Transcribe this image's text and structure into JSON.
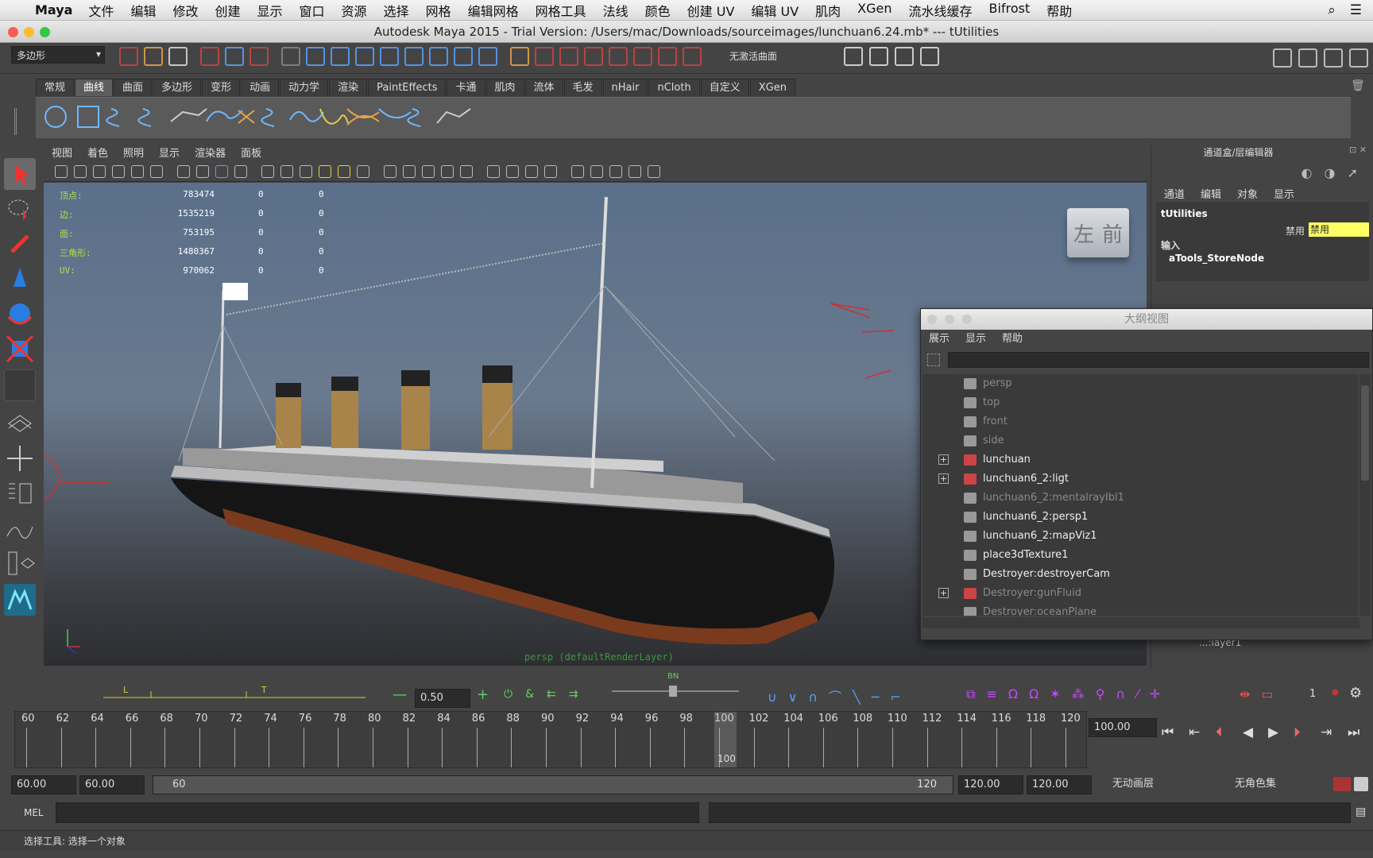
{
  "menubar": {
    "app": "Maya",
    "items": [
      "文件",
      "编辑",
      "修改",
      "创建",
      "显示",
      "窗口",
      "资源",
      "选择",
      "网格",
      "编辑网格",
      "网格工具",
      "法线",
      "颜色",
      "创建 UV",
      "编辑 UV",
      "肌肉",
      "XGen",
      "流水线缓存",
      "Bifrost",
      "帮助"
    ]
  },
  "window": {
    "title": "Autodesk Maya 2015 - Trial Version: /Users/mac/Downloads/sourceimages/lunchuan6.24.mb*   ---   tUtilities"
  },
  "statusline": {
    "menuset": "多边形",
    "live_surface": "无激活曲面"
  },
  "shelf": {
    "tabs": [
      "常规",
      "曲线",
      "曲面",
      "多边形",
      "变形",
      "动画",
      "动力学",
      "渲染",
      "PaintEffects",
      "卡通",
      "肌肉",
      "流体",
      "毛发",
      "nHair",
      "nCloth",
      "自定义",
      "XGen"
    ],
    "active": "曲线"
  },
  "viewport": {
    "menu": [
      "视图",
      "着色",
      "照明",
      "显示",
      "渲染器",
      "面板"
    ],
    "hud": [
      {
        "label": "顶点:",
        "v": "783474",
        "a": "0",
        "b": "0"
      },
      {
        "label": "边:",
        "v": "1535219",
        "a": "0",
        "b": "0"
      },
      {
        "label": "面:",
        "v": "753195",
        "a": "0",
        "b": "0"
      },
      {
        "label": "三角形:",
        "v": "1480367",
        "a": "0",
        "b": "0"
      },
      {
        "label": "UV:",
        "v": "970062",
        "a": "0",
        "b": "0"
      }
    ],
    "camera_label": "persp (defaultRenderLayer)",
    "viewcube_left": "左",
    "viewcube_front": "前"
  },
  "channelbox": {
    "title": "通道盒/层编辑器",
    "menu": [
      "通道",
      "编辑",
      "对象",
      "显示"
    ],
    "node": "tUtilities",
    "attr_label": "禁用",
    "attr_value": "禁用",
    "inputs_label": "输入",
    "input_node": "aTools_StoreNode",
    "layer": "...:layer1"
  },
  "outliner": {
    "title": "大纲视图",
    "menu": [
      "展示",
      "显示",
      "帮助"
    ],
    "rows": [
      {
        "name": "persp",
        "dim": true,
        "exp": false
      },
      {
        "name": "top",
        "dim": true,
        "exp": false
      },
      {
        "name": "front",
        "dim": true,
        "exp": false
      },
      {
        "name": "side",
        "dim": true,
        "exp": false
      },
      {
        "name": "lunchuan",
        "dim": false,
        "exp": true
      },
      {
        "name": "lunchuan6_2:ligt",
        "dim": false,
        "exp": true
      },
      {
        "name": "lunchuan6_2:mentalrayIbl1",
        "dim": true,
        "exp": false
      },
      {
        "name": "lunchuan6_2:persp1",
        "dim": false,
        "exp": false
      },
      {
        "name": "lunchuan6_2:mapViz1",
        "dim": false,
        "exp": false
      },
      {
        "name": "place3dTexture1",
        "dim": false,
        "exp": false
      },
      {
        "name": "Destroyer:destroyerCam",
        "dim": false,
        "exp": false
      },
      {
        "name": "Destroyer:gunFluid",
        "dim": true,
        "exp": true
      },
      {
        "name": "Destroyer:oceanPlane",
        "dim": true,
        "exp": false
      }
    ]
  },
  "playbar": {
    "key_l": "L",
    "key_t": "T",
    "value": "0.50",
    "bn": "BN",
    "frame_num": "1"
  },
  "timeline": {
    "ticks": [
      "60",
      "62",
      "64",
      "66",
      "68",
      "70",
      "72",
      "74",
      "76",
      "78",
      "80",
      "82",
      "84",
      "86",
      "88",
      "90",
      "92",
      "94",
      "96",
      "98",
      "100",
      "102",
      "104",
      "106",
      "108",
      "110",
      "112",
      "114",
      "116",
      "118",
      "120"
    ],
    "current": "100",
    "current_field": "100.00"
  },
  "range": {
    "start": "60.00",
    "start2": "60.00",
    "slider_start": "60",
    "slider_end": "120",
    "end": "120.00",
    "end2": "120.00",
    "anim_layer": "无动画层",
    "char_set": "无角色集"
  },
  "mel": {
    "label": "MEL"
  },
  "help": {
    "text": "选择工具: 选择一个对象"
  },
  "colors": {
    "accent": "#5d5d5d",
    "hud_label": "#aee04a",
    "highlight": "#ffff66"
  }
}
